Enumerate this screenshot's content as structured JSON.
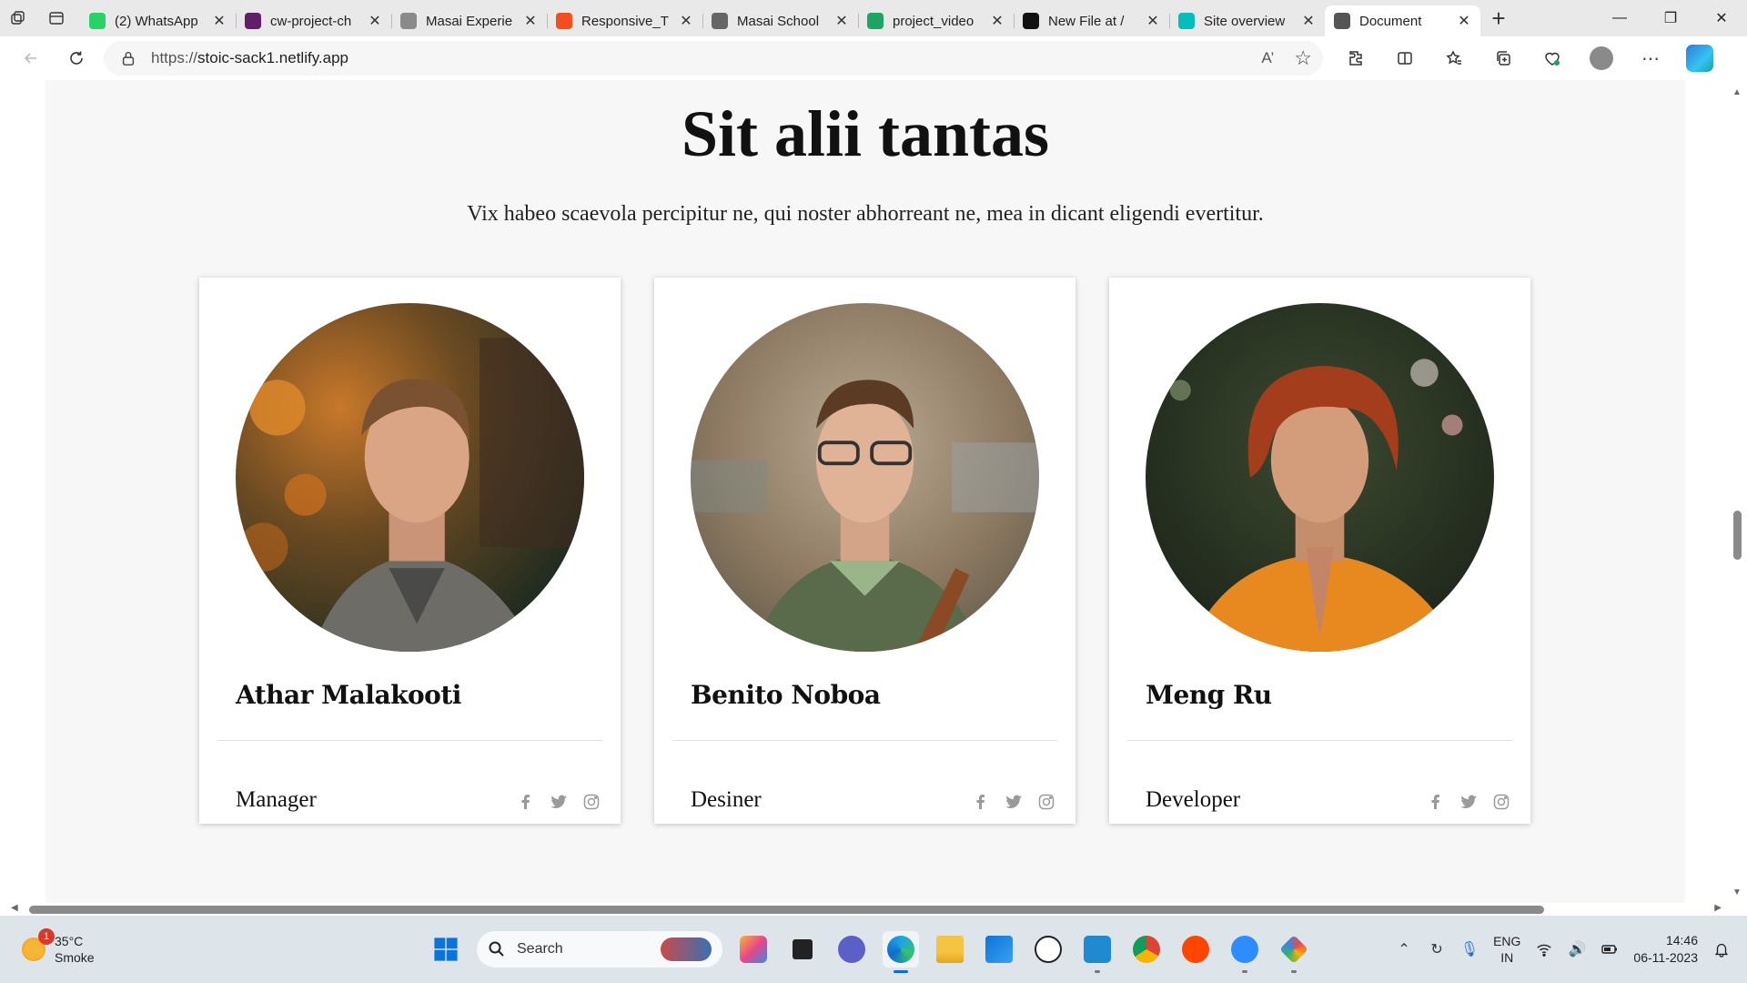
{
  "browser": {
    "tabs": [
      {
        "title": "(2) WhatsApp",
        "favicon": "whatsapp-icon",
        "color": "#25d366",
        "active": false
      },
      {
        "title": "cw-project-ch",
        "favicon": "slack-icon",
        "color": "#611f69",
        "active": false
      },
      {
        "title": "Masai Experie",
        "favicon": "masai-icon",
        "color": "#8a8a8a",
        "active": false
      },
      {
        "title": "Responsive_T",
        "favicon": "figma-icon",
        "color": "#f24e1e",
        "active": false
      },
      {
        "title": "Masai School",
        "favicon": "document-icon",
        "color": "#666666",
        "active": false
      },
      {
        "title": "project_video",
        "favicon": "google-drive-icon",
        "color": "#1fa463",
        "active": false
      },
      {
        "title": "New File at /",
        "favicon": "github-icon",
        "color": "#111111",
        "active": false
      },
      {
        "title": "Site overview",
        "favicon": "netlify-icon",
        "color": "#05bdba",
        "active": false
      },
      {
        "title": "Document",
        "favicon": "document-icon",
        "color": "#555555",
        "active": true
      }
    ],
    "url_protocol": "https://",
    "url_host": "stoic-sack1.netlify.app"
  },
  "page": {
    "heading": "Sit alii tantas",
    "subheading": "Vix habeo scaevola percipitur ne, qui noster abhorreant ne, mea in dicant eligendi evertitur.",
    "team": [
      {
        "name": "Athar Malakooti",
        "role": "Manager"
      },
      {
        "name": "Benito Noboa",
        "role": "Desiner"
      },
      {
        "name": "Meng Ru",
        "role": "Developer"
      }
    ]
  },
  "taskbar": {
    "weather_temp": "35°C",
    "weather_desc": "Smoke",
    "weather_badge": "1",
    "search_label": "Search",
    "lang_line1": "ENG",
    "lang_line2": "IN",
    "time": "14:46",
    "date": "06-11-2023"
  }
}
